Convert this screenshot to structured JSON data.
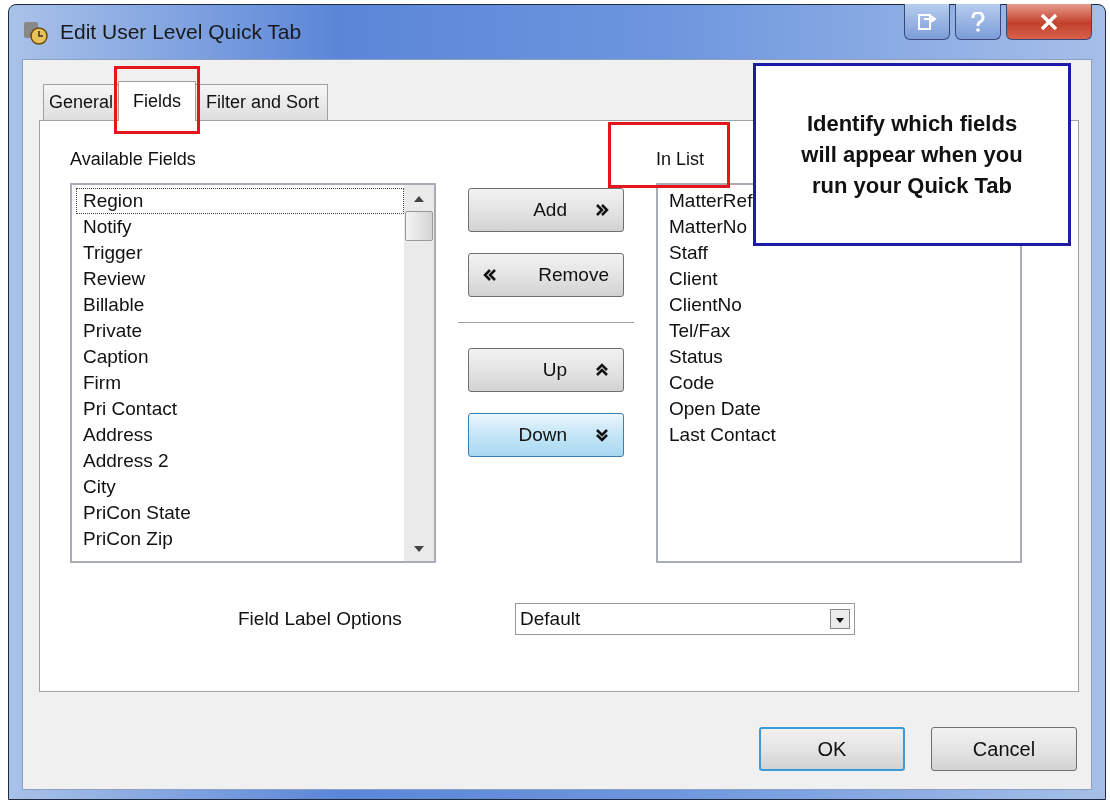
{
  "window": {
    "title": "Edit User Level Quick Tab"
  },
  "tabs": [
    {
      "label": "General",
      "selected": false
    },
    {
      "label": "Fields",
      "selected": true
    },
    {
      "label": "Filter and Sort",
      "selected": false
    }
  ],
  "available_fields": {
    "label": "Available Fields",
    "items": [
      {
        "text": "Region",
        "focused": true
      },
      {
        "text": "Notify",
        "focused": false
      },
      {
        "text": "Trigger",
        "focused": false
      },
      {
        "text": "Review",
        "focused": false
      },
      {
        "text": "Billable",
        "focused": false
      },
      {
        "text": "Private",
        "focused": false
      },
      {
        "text": "Caption",
        "focused": false
      },
      {
        "text": "Firm",
        "focused": false
      },
      {
        "text": "Pri Contact",
        "focused": false
      },
      {
        "text": "Address",
        "focused": false
      },
      {
        "text": "Address 2",
        "focused": false
      },
      {
        "text": "City",
        "focused": false
      },
      {
        "text": "PriCon State",
        "focused": false
      },
      {
        "text": "PriCon Zip",
        "focused": false
      }
    ]
  },
  "move_buttons": [
    {
      "label": "Add",
      "kind": "add",
      "hovered": false
    },
    {
      "label": "Remove",
      "kind": "remove",
      "hovered": false
    },
    {
      "label": "Up",
      "kind": "up",
      "hovered": false
    },
    {
      "label": "Down",
      "kind": "down",
      "hovered": true
    }
  ],
  "in_list": {
    "label": "In List",
    "items": [
      "MatterRef",
      "MatterNo",
      "Staff",
      "Client",
      "ClientNo",
      "Tel/Fax",
      "Status",
      "Code",
      "Open Date",
      "Last Contact"
    ]
  },
  "field_label_options": {
    "label": "Field Label Options",
    "value": "Default"
  },
  "dialog_buttons": [
    {
      "label": "OK",
      "default": true
    },
    {
      "label": "Cancel",
      "default": false
    }
  ],
  "callout": {
    "text": "Identify which fields will appear when you run your Quick Tab"
  }
}
